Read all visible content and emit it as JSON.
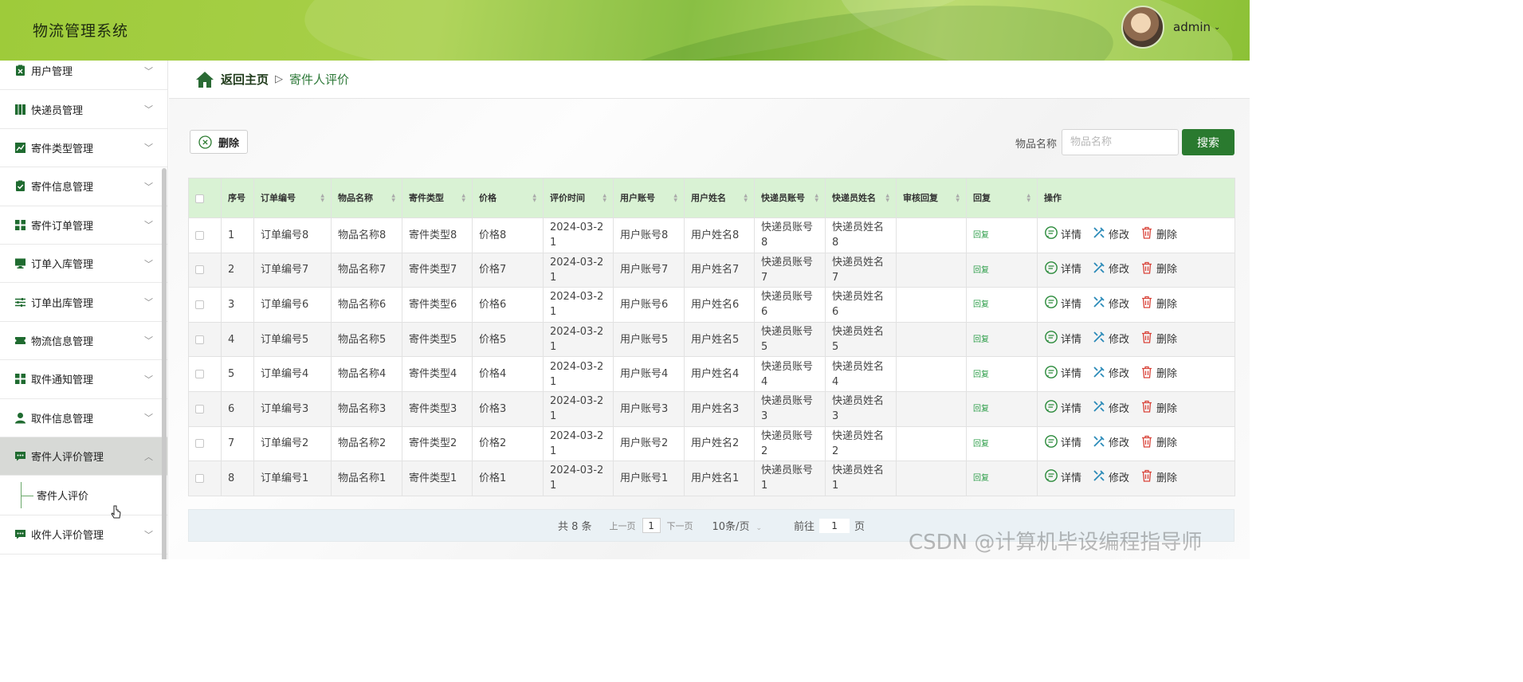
{
  "header": {
    "app_title": "物流管理系统",
    "user": "admin"
  },
  "sidebar": {
    "items": [
      {
        "label": "用户管理",
        "icon": "clipboard-x-icon"
      },
      {
        "label": "快递员管理",
        "icon": "books-icon"
      },
      {
        "label": "寄件类型管理",
        "icon": "chart-icon"
      },
      {
        "label": "寄件信息管理",
        "icon": "clipboard-check-icon"
      },
      {
        "label": "寄件订单管理",
        "icon": "grid-icon"
      },
      {
        "label": "订单入库管理",
        "icon": "monitor-icon"
      },
      {
        "label": "订单出库管理",
        "icon": "sliders-icon"
      },
      {
        "label": "物流信息管理",
        "icon": "ticket-icon"
      },
      {
        "label": "取件通知管理",
        "icon": "grid-icon"
      },
      {
        "label": "取件信息管理",
        "icon": "user-icon"
      },
      {
        "label": "寄件人评价管理",
        "icon": "chat-icon"
      },
      {
        "label": "收件人评价管理",
        "icon": "chat-icon"
      }
    ],
    "submenu": {
      "label": "寄件人评价"
    }
  },
  "breadcrumb": {
    "home": "返回主页",
    "separator": "▷",
    "current": "寄件人评价"
  },
  "toolbar": {
    "delete_label": "删除",
    "search_label": "物品名称",
    "search_placeholder": "物品名称",
    "search_value": "",
    "search_button": "搜索"
  },
  "table": {
    "columns": [
      "序号",
      "订单编号",
      "物品名称",
      "寄件类型",
      "价格",
      "评价时间",
      "用户账号",
      "用户姓名",
      "快递员账号",
      "快递员姓名",
      "审核回复",
      "回复",
      "操作"
    ],
    "reply_text": "回复",
    "actions": {
      "detail": "详情",
      "edit": "修改",
      "delete": "删除"
    },
    "rows": [
      {
        "index": "1",
        "order": "订单编号8",
        "item": "物品名称8",
        "type": "寄件类型8",
        "price": "价格8",
        "time": "2024-03-21",
        "user_account": "用户账号8",
        "user_name": "用户姓名8",
        "courier_account": "快递员账号8",
        "courier_name": "快递员姓名8",
        "review_reply": ""
      },
      {
        "index": "2",
        "order": "订单编号7",
        "item": "物品名称7",
        "type": "寄件类型7",
        "price": "价格7",
        "time": "2024-03-21",
        "user_account": "用户账号7",
        "user_name": "用户姓名7",
        "courier_account": "快递员账号7",
        "courier_name": "快递员姓名7",
        "review_reply": ""
      },
      {
        "index": "3",
        "order": "订单编号6",
        "item": "物品名称6",
        "type": "寄件类型6",
        "price": "价格6",
        "time": "2024-03-21",
        "user_account": "用户账号6",
        "user_name": "用户姓名6",
        "courier_account": "快递员账号6",
        "courier_name": "快递员姓名6",
        "review_reply": ""
      },
      {
        "index": "4",
        "order": "订单编号5",
        "item": "物品名称5",
        "type": "寄件类型5",
        "price": "价格5",
        "time": "2024-03-21",
        "user_account": "用户账号5",
        "user_name": "用户姓名5",
        "courier_account": "快递员账号5",
        "courier_name": "快递员姓名5",
        "review_reply": ""
      },
      {
        "index": "5",
        "order": "订单编号4",
        "item": "物品名称4",
        "type": "寄件类型4",
        "price": "价格4",
        "time": "2024-03-21",
        "user_account": "用户账号4",
        "user_name": "用户姓名4",
        "courier_account": "快递员账号4",
        "courier_name": "快递员姓名4",
        "review_reply": ""
      },
      {
        "index": "6",
        "order": "订单编号3",
        "item": "物品名称3",
        "type": "寄件类型3",
        "price": "价格3",
        "time": "2024-03-21",
        "user_account": "用户账号3",
        "user_name": "用户姓名3",
        "courier_account": "快递员账号3",
        "courier_name": "快递员姓名3",
        "review_reply": ""
      },
      {
        "index": "7",
        "order": "订单编号2",
        "item": "物品名称2",
        "type": "寄件类型2",
        "price": "价格2",
        "time": "2024-03-21",
        "user_account": "用户账号2",
        "user_name": "用户姓名2",
        "courier_account": "快递员账号2",
        "courier_name": "快递员姓名2",
        "review_reply": ""
      },
      {
        "index": "8",
        "order": "订单编号1",
        "item": "物品名称1",
        "type": "寄件类型1",
        "price": "价格1",
        "time": "2024-03-21",
        "user_account": "用户账号1",
        "user_name": "用户姓名1",
        "courier_account": "快递员账号1",
        "courier_name": "快递员姓名1",
        "review_reply": ""
      }
    ]
  },
  "pagination": {
    "total": "共 8 条",
    "prev": "上一页",
    "current_page": "1",
    "next": "下一页",
    "page_size": "10条/页",
    "goto_label": "前往",
    "goto_value": "1",
    "goto_unit": "页"
  },
  "watermark": "CSDN @计算机毕设编程指导师",
  "colors": {
    "primary": "#2a7a2f",
    "header_green": "#9ecb3a",
    "table_header": "#d9f2d4",
    "reply_link": "#2e9e4a"
  }
}
